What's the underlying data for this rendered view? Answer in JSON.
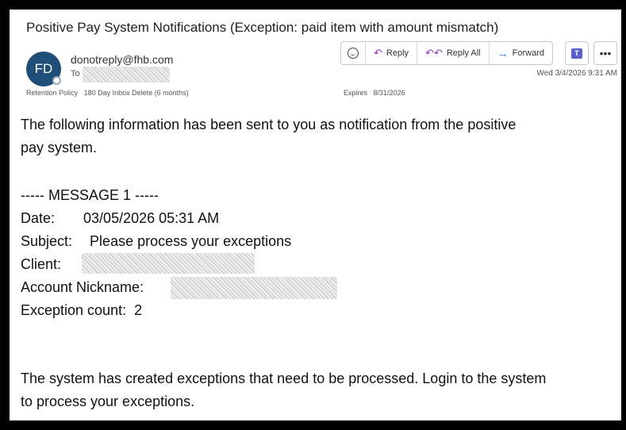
{
  "email": {
    "subject": "Positive Pay System Notifications (Exception: paid item with amount mismatch)",
    "avatar_initials": "FD",
    "sender": "donotreply@fhb.com",
    "to_label": "To",
    "retention_policy": "Retention Policy",
    "retention_value": "180 Day Inbox Delete (6 months)",
    "expires_label": "Expires",
    "expires_value": "8/31/2026",
    "received": "Wed 3/4/2026 9:31 AM"
  },
  "toolbar": {
    "reply": "Reply",
    "reply_all": "Reply All",
    "forward": "Forward",
    "teams_glyph": "T",
    "more_glyph": "•••"
  },
  "body": {
    "intro_line1": "The following information has been sent to you as notification from the positive",
    "intro_line2": "pay system.",
    "message_header": "----- MESSAGE 1 -----",
    "date_label": "Date:",
    "date_value": "03/05/2026 05:31 AM",
    "subject_label": "Subject:",
    "subject_value": "Please process your exceptions",
    "client_label": "Client:",
    "nickname_label": "Account Nickname:",
    "count_label": "Exception count:",
    "count_value": "2",
    "closing_line1": "The system has created exceptions that need to be processed. Login to the system",
    "closing_line2": "to process your exceptions."
  }
}
